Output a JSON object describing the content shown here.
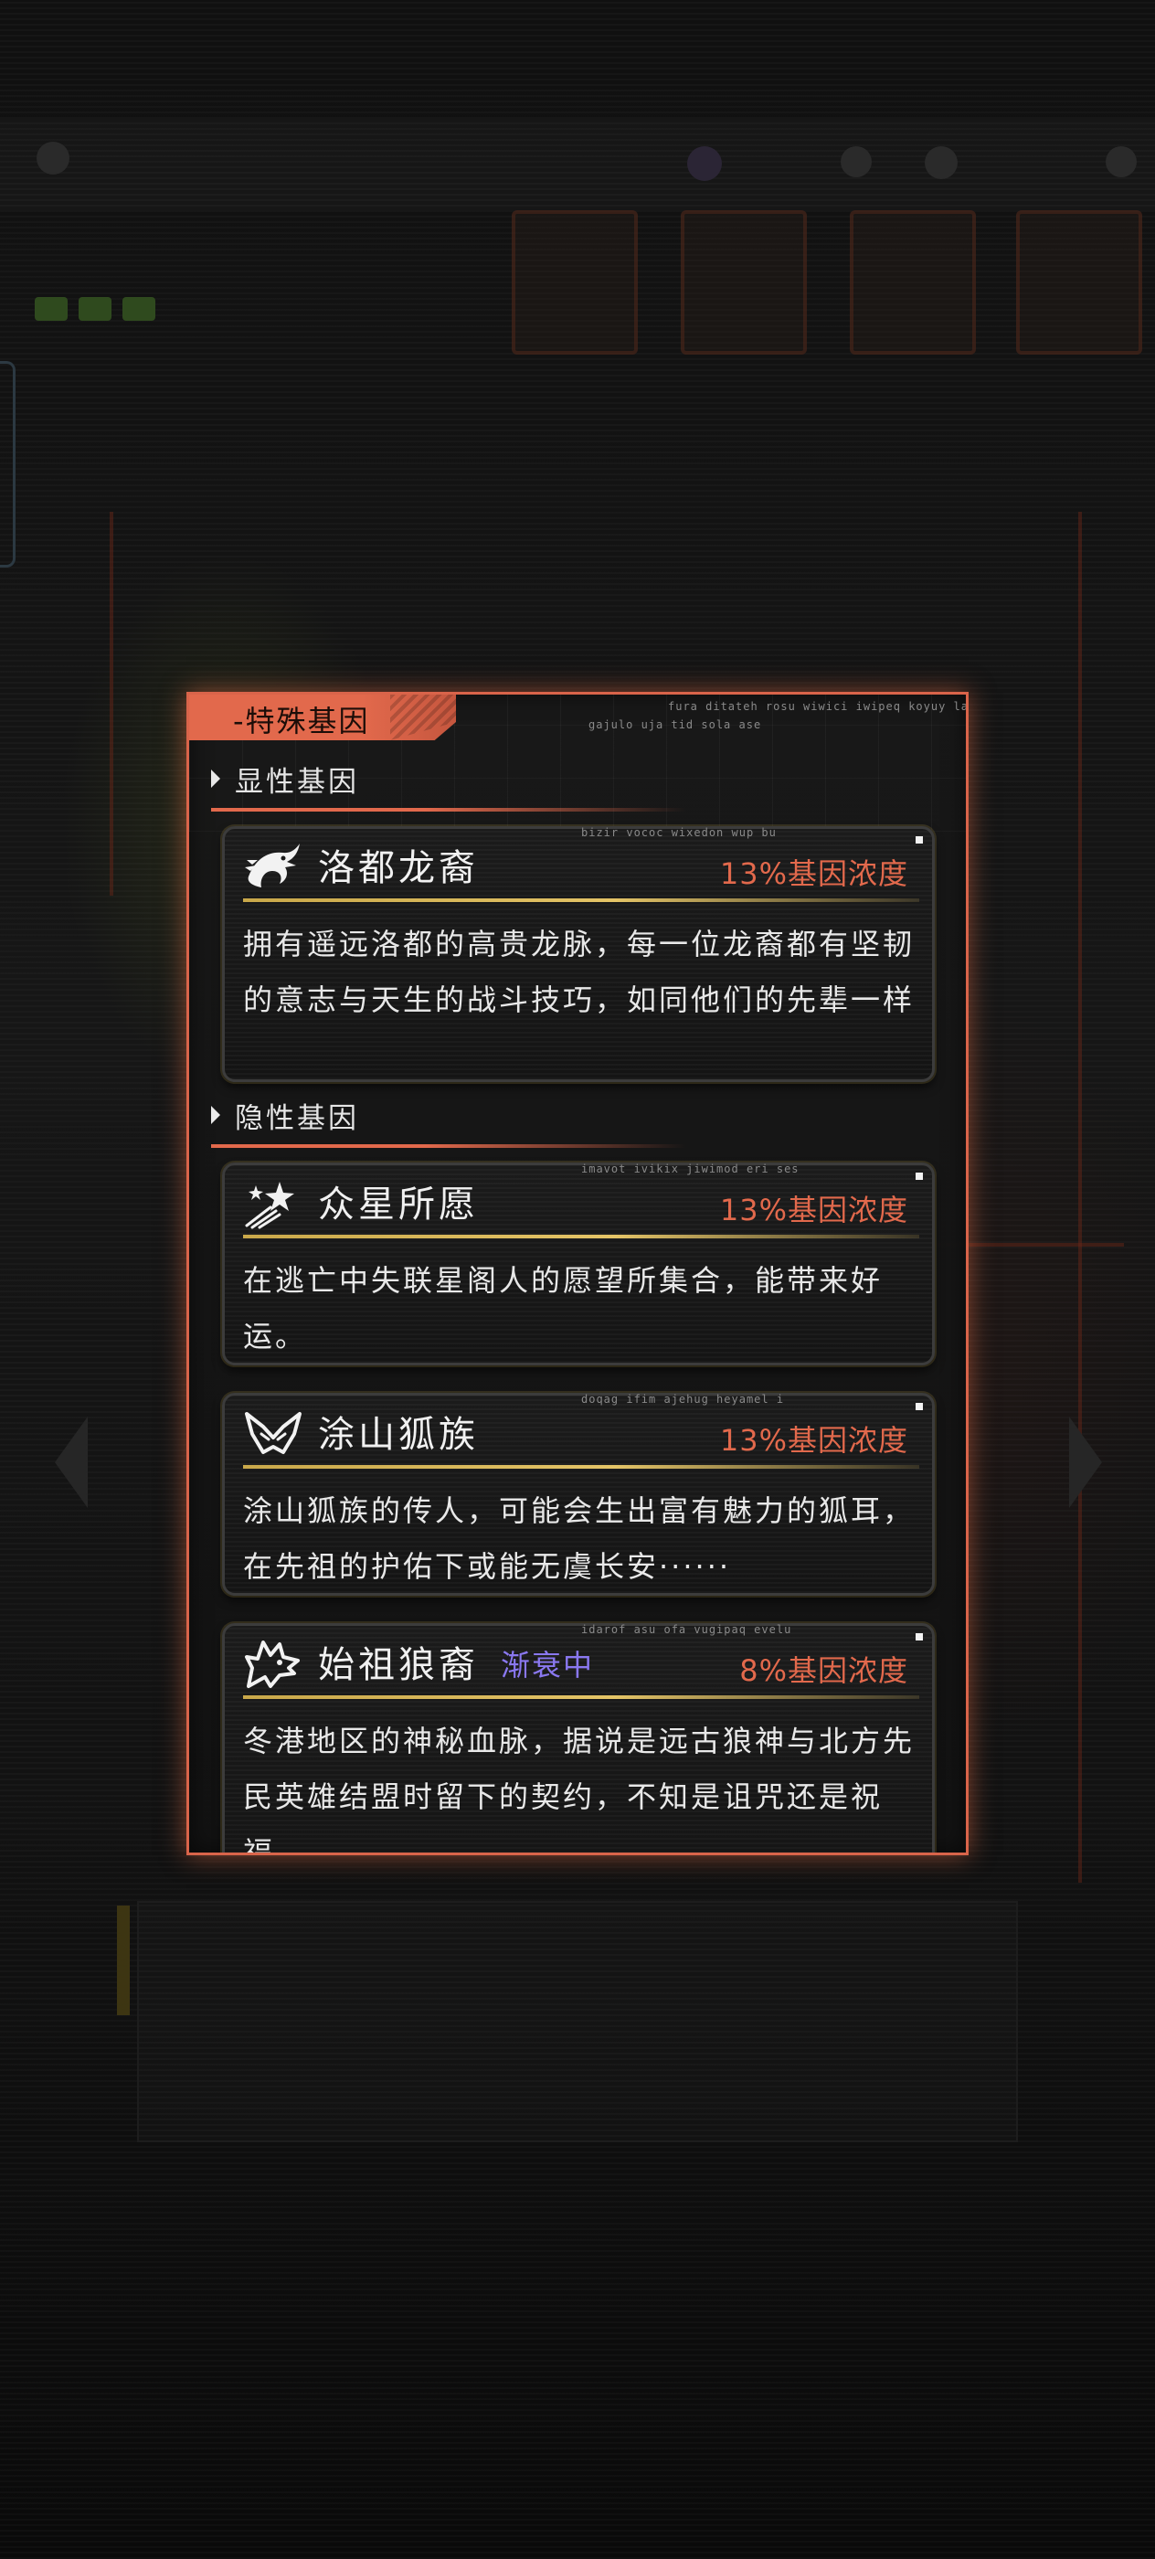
{
  "panel": {
    "title": "-特殊基因",
    "deco_text_1": "fura ditateh rosu wiwici iwipeq koyuy la",
    "deco_text_2": "gajulo uja tid sola ase"
  },
  "sections": {
    "dominant": {
      "label": "显性基因"
    },
    "recessive": {
      "label": "隐性基因"
    }
  },
  "genes": [
    {
      "name": "洛都龙裔",
      "icon": "dragon-icon",
      "concentration": "13%基因浓度",
      "status": "",
      "deco": "bizir vococ wixedon wup bu",
      "description": "拥有遥远洛都的高贵龙脉，每一位龙裔都有坚韧的意志与天生的战斗技巧，如同他们的先辈一样"
    },
    {
      "name": "众星所愿",
      "icon": "shooting-stars-icon",
      "concentration": "13%基因浓度",
      "status": "",
      "deco": "imavot ivikix jiwimod eri ses",
      "description": "在逃亡中失联星阁人的愿望所集合，能带来好运。"
    },
    {
      "name": "涂山狐族",
      "icon": "fox-icon",
      "concentration": "13%基因浓度",
      "status": "",
      "deco": "doqag ifim ajehug heyamel i",
      "description": "涂山狐族的传人，可能会生出富有魅力的狐耳，在先祖的护佑下或能无虞长安······"
    },
    {
      "name": "始祖狼裔",
      "icon": "wolf-icon",
      "concentration": "8%基因浓度",
      "status": "渐衰中",
      "deco": "idarof asu ofa vugipaq evelu",
      "description": "冬港地区的神秘血脉，据说是远古狼神与北方先民英雄结盟时留下的契约，不知是诅咒还是祝福……"
    }
  ],
  "colors": {
    "accent": "#e2694c",
    "divider_gold": "#e4c467",
    "status_purple": "#8a78f0"
  }
}
